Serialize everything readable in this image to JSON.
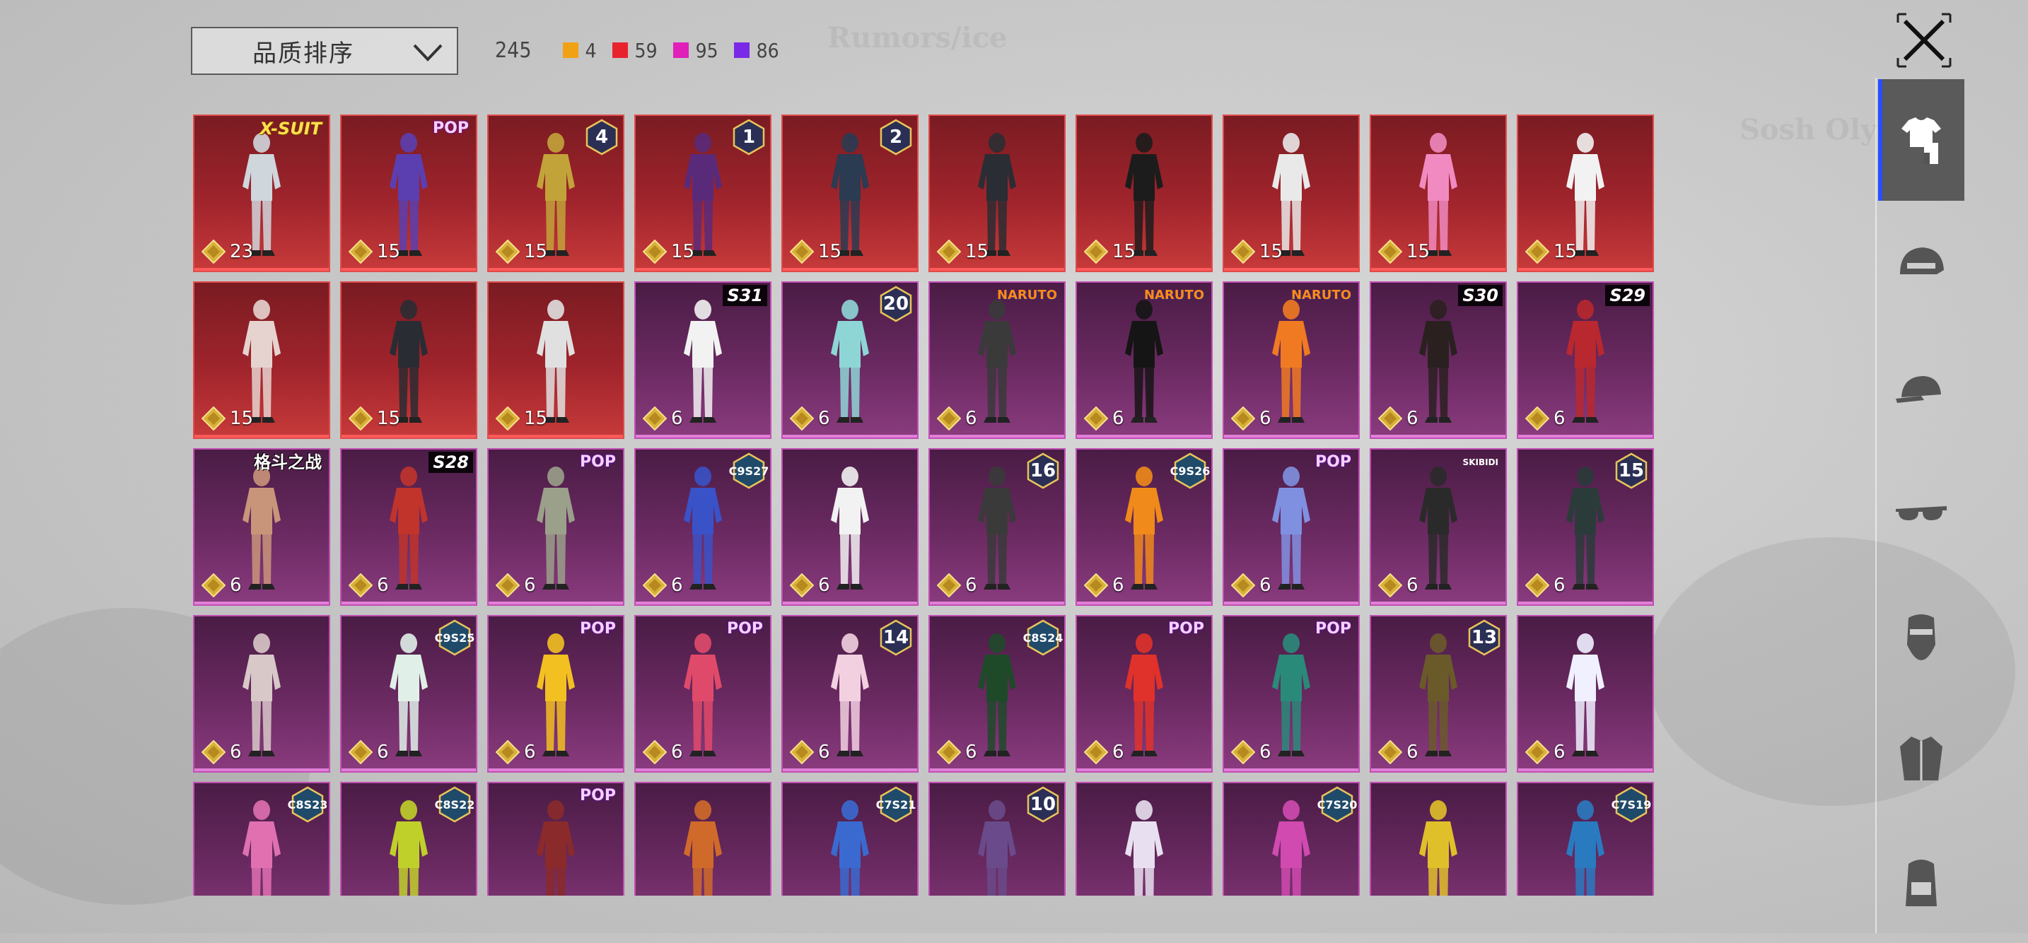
{
  "sort": {
    "label": "品质排序"
  },
  "counts": {
    "total": "245",
    "rarities": [
      {
        "color": "#f1a214",
        "count": "4"
      },
      {
        "color": "#e8232e",
        "count": "59"
      },
      {
        "color": "#e020b8",
        "count": "95"
      },
      {
        "color": "#7a2ae6",
        "count": "86"
      }
    ]
  },
  "colors": {
    "active_tab_accent": "#2a4dff",
    "red_card": "#a0242c",
    "purple_card": "#6b2a62"
  },
  "items": [
    {
      "rarity": "red",
      "value": "23",
      "badge": "X-SUIT",
      "badge_style": "gold",
      "tint": "#cfd6dc"
    },
    {
      "rarity": "red",
      "value": "15",
      "badge": "POP",
      "badge_style": "logo",
      "tint": "#5b3fb0"
    },
    {
      "rarity": "red",
      "value": "15",
      "badge": "4",
      "badge_style": "hex",
      "tint": "#c2a33a"
    },
    {
      "rarity": "red",
      "value": "15",
      "badge": "1",
      "badge_style": "hex",
      "tint": "#5a2a7a"
    },
    {
      "rarity": "red",
      "value": "15",
      "badge": "2",
      "badge_style": "hex",
      "tint": "#2a3b52"
    },
    {
      "rarity": "red",
      "value": "15",
      "badge": "",
      "badge_style": "",
      "tint": "#2a2d33"
    },
    {
      "rarity": "red",
      "value": "15",
      "badge": "",
      "badge_style": "",
      "tint": "#1c1c1c"
    },
    {
      "rarity": "red",
      "value": "15",
      "badge": "",
      "badge_style": "",
      "tint": "#e9e9e9"
    },
    {
      "rarity": "red",
      "value": "15",
      "badge": "",
      "badge_style": "",
      "tint": "#f08ac0"
    },
    {
      "rarity": "red",
      "value": "15",
      "badge": "",
      "badge_style": "",
      "tint": "#f2f2f2"
    },
    {
      "rarity": "red",
      "value": "15",
      "badge": "",
      "badge_style": "",
      "tint": "#e6d3cf"
    },
    {
      "rarity": "red",
      "value": "15",
      "badge": "",
      "badge_style": "",
      "tint": "#2a2c33"
    },
    {
      "rarity": "red",
      "value": "15",
      "badge": "",
      "badge_style": "",
      "tint": "#e0e0e0"
    },
    {
      "rarity": "purple",
      "value": "6",
      "badge": "S31",
      "badge_style": "box",
      "tint": "#f2f2f2"
    },
    {
      "rarity": "purple",
      "value": "6",
      "badge": "20",
      "badge_style": "hex",
      "tint": "#8ed6d6"
    },
    {
      "rarity": "purple",
      "value": "6",
      "badge": "NARUTO",
      "badge_style": "naruto",
      "tint": "#3a3a3a"
    },
    {
      "rarity": "purple",
      "value": "6",
      "badge": "NARUTO",
      "badge_style": "naruto",
      "tint": "#151515"
    },
    {
      "rarity": "purple",
      "value": "6",
      "badge": "NARUTO",
      "badge_style": "naruto",
      "tint": "#ef7a22"
    },
    {
      "rarity": "purple",
      "value": "6",
      "badge": "S30",
      "badge_style": "box",
      "tint": "#2a2020"
    },
    {
      "rarity": "purple",
      "value": "6",
      "badge": "S29",
      "badge_style": "box",
      "tint": "#b8282e"
    },
    {
      "rarity": "purple",
      "value": "6",
      "badge": "格斗之战",
      "badge_style": "kanji",
      "tint": "#c9957a"
    },
    {
      "rarity": "purple",
      "value": "6",
      "badge": "S28",
      "badge_style": "box",
      "tint": "#c0342c"
    },
    {
      "rarity": "purple",
      "value": "6",
      "badge": "POP",
      "badge_style": "logo",
      "tint": "#9aa08a"
    },
    {
      "rarity": "purple",
      "value": "6",
      "badge": "C9S27",
      "badge_style": "hex-text",
      "tint": "#3a52c8"
    },
    {
      "rarity": "purple",
      "value": "6",
      "badge": "",
      "badge_style": "",
      "tint": "#f2f2f2"
    },
    {
      "rarity": "purple",
      "value": "6",
      "badge": "16",
      "badge_style": "hex",
      "tint": "#3a3a3a"
    },
    {
      "rarity": "purple",
      "value": "6",
      "badge": "C9S26",
      "badge_style": "hex-text",
      "tint": "#f08a1a"
    },
    {
      "rarity": "purple",
      "value": "6",
      "badge": "POP",
      "badge_style": "logo",
      "tint": "#8090e0"
    },
    {
      "rarity": "purple",
      "value": "6",
      "badge": "SKIBIDI",
      "badge_style": "small",
      "tint": "#2a2a2a"
    },
    {
      "rarity": "purple",
      "value": "6",
      "badge": "15",
      "badge_style": "hex",
      "tint": "#2a3b3a"
    },
    {
      "rarity": "purple",
      "value": "6",
      "badge": "",
      "badge_style": "",
      "tint": "#d8c8c8"
    },
    {
      "rarity": "purple",
      "value": "6",
      "badge": "C9S25",
      "badge_style": "hex-text",
      "tint": "#e0f0e8"
    },
    {
      "rarity": "purple",
      "value": "6",
      "badge": "POP",
      "badge_style": "logo",
      "tint": "#f2c020"
    },
    {
      "rarity": "purple",
      "value": "6",
      "badge": "POP",
      "badge_style": "logo",
      "tint": "#e04a6a"
    },
    {
      "rarity": "purple",
      "value": "6",
      "badge": "14",
      "badge_style": "hex",
      "tint": "#f2d0e0"
    },
    {
      "rarity": "purple",
      "value": "6",
      "badge": "C8S24",
      "badge_style": "hex-text",
      "tint": "#1f4a2a"
    },
    {
      "rarity": "purple",
      "value": "6",
      "badge": "POP",
      "badge_style": "logo",
      "tint": "#e0322a"
    },
    {
      "rarity": "purple",
      "value": "6",
      "badge": "POP",
      "badge_style": "logo",
      "tint": "#2a8a7a"
    },
    {
      "rarity": "purple",
      "value": "6",
      "badge": "13",
      "badge_style": "hex",
      "tint": "#6a5a2a"
    },
    {
      "rarity": "purple",
      "value": "6",
      "badge": "",
      "badge_style": "",
      "tint": "#f0f0ff"
    },
    {
      "rarity": "purple",
      "value": "",
      "badge": "C8S23",
      "badge_style": "hex-text",
      "tint": "#e070b0"
    },
    {
      "rarity": "purple",
      "value": "",
      "badge": "C8S22",
      "badge_style": "hex-text",
      "tint": "#c0d02a"
    },
    {
      "rarity": "purple",
      "value": "",
      "badge": "POP",
      "badge_style": "logo",
      "tint": "#8a2a2a"
    },
    {
      "rarity": "purple",
      "value": "",
      "badge": "",
      "badge_style": "",
      "tint": "#d06a2a"
    },
    {
      "rarity": "purple",
      "value": "",
      "badge": "C7S21",
      "badge_style": "hex-text",
      "tint": "#3a6ad0"
    },
    {
      "rarity": "purple",
      "value": "",
      "badge": "10",
      "badge_style": "hex",
      "tint": "#6a4a8a"
    },
    {
      "rarity": "purple",
      "value": "",
      "badge": "",
      "badge_style": "",
      "tint": "#e8e0f0"
    },
    {
      "rarity": "purple",
      "value": "",
      "badge": "C7S20",
      "badge_style": "hex-text",
      "tint": "#d04ab0"
    },
    {
      "rarity": "purple",
      "value": "",
      "badge": "",
      "badge_style": "",
      "tint": "#e0c02a"
    },
    {
      "rarity": "purple",
      "value": "",
      "badge": "C7S19",
      "badge_style": "hex-text",
      "tint": "#2a7ac0"
    }
  ],
  "side_tabs": [
    {
      "icon": "outfit-icon",
      "active": true
    },
    {
      "icon": "helmet-icon",
      "active": false
    },
    {
      "icon": "cap-icon",
      "active": false
    },
    {
      "icon": "glasses-icon",
      "active": false
    },
    {
      "icon": "mask-icon",
      "active": false
    },
    {
      "icon": "jacket-icon",
      "active": false
    },
    {
      "icon": "backpack-icon",
      "active": false
    }
  ]
}
